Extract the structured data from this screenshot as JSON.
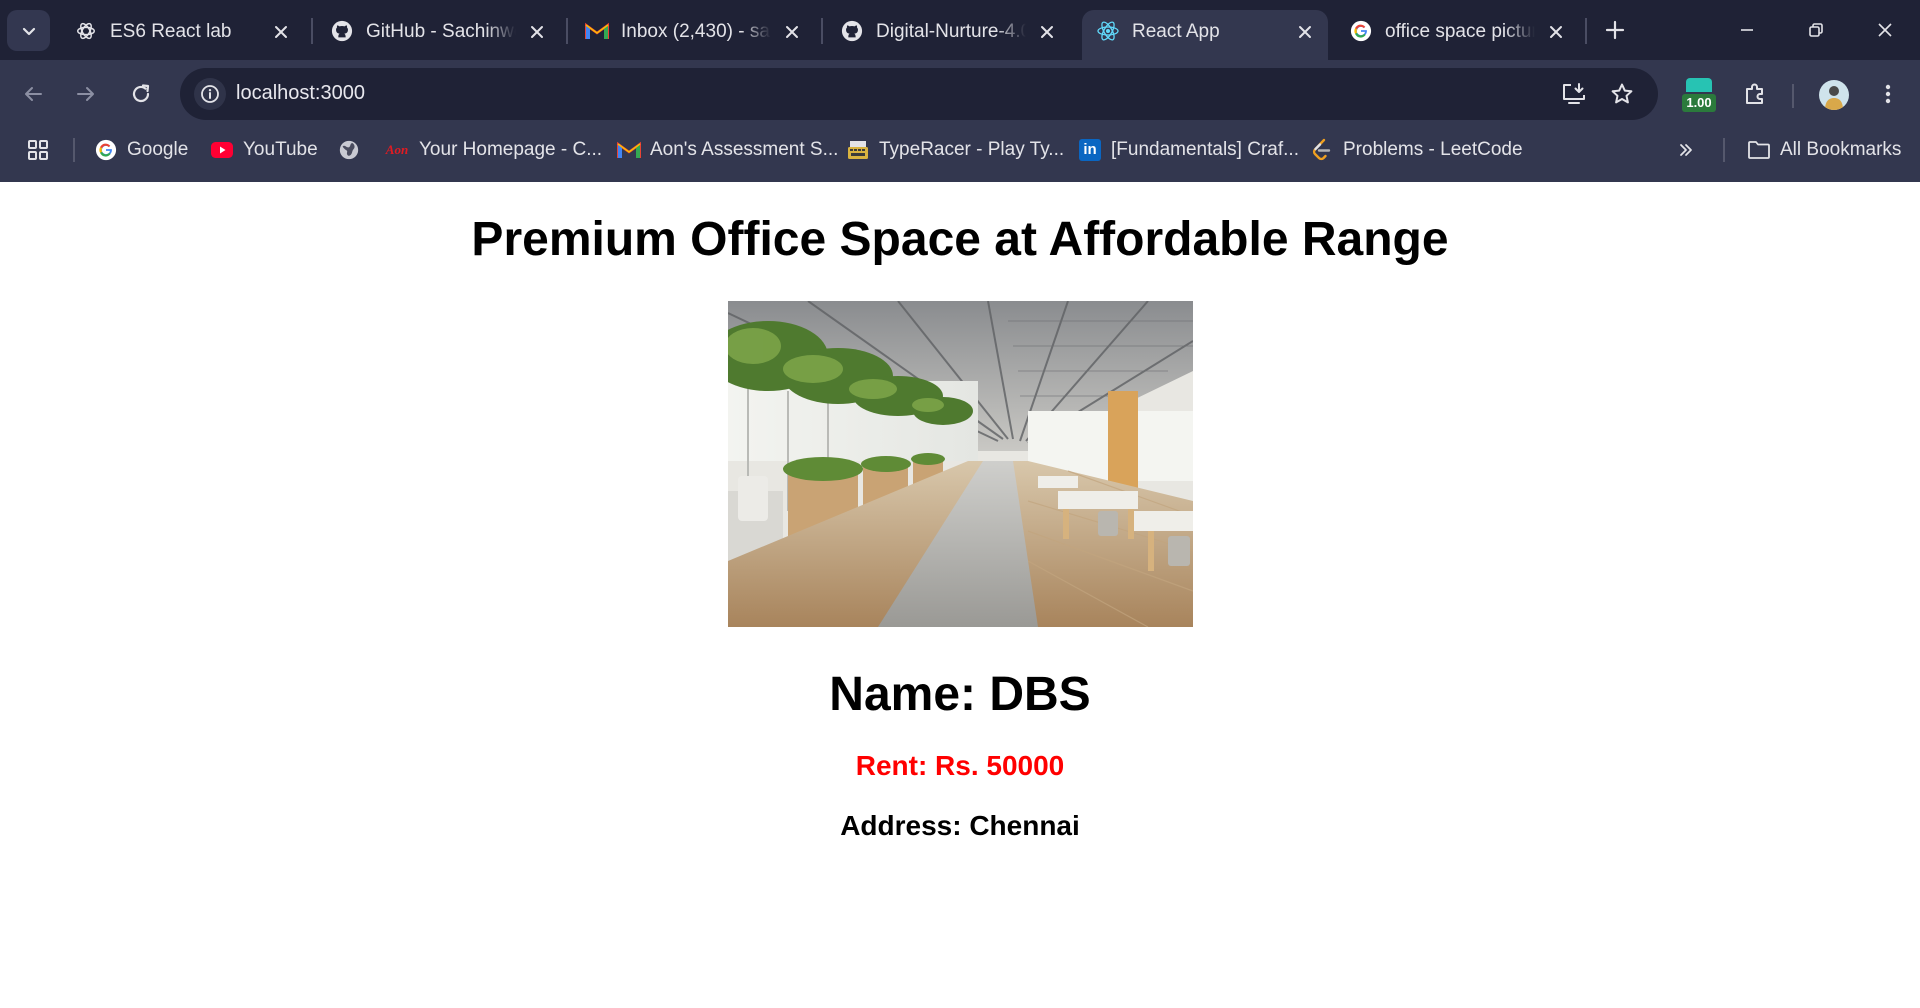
{
  "browser": {
    "tabs": [
      {
        "title": "ES6 React lab",
        "icon": "chatgpt-icon",
        "active": false
      },
      {
        "title": "GitHub - Sachinwe",
        "icon": "github-icon",
        "active": false
      },
      {
        "title": "Inbox (2,430) - sac",
        "icon": "gmail-icon",
        "active": false
      },
      {
        "title": "Digital-Nurture-4.0",
        "icon": "github-icon",
        "active": false
      },
      {
        "title": "React App",
        "icon": "react-icon",
        "active": true
      },
      {
        "title": "office space pictur",
        "icon": "google-icon",
        "active": false
      }
    ],
    "address_bar": {
      "url": "localhost:3000"
    },
    "extension_badge": "1.00",
    "bookmarks": [
      {
        "label": "Google",
        "icon": "google-icon"
      },
      {
        "label": "YouTube",
        "icon": "youtube-icon"
      },
      {
        "label": "",
        "icon": "globe-icon"
      },
      {
        "label": "Your Homepage - C...",
        "icon": "aon-icon"
      },
      {
        "label": "Aon's Assessment S...",
        "icon": "gmail-icon"
      },
      {
        "label": "TypeRacer - Play Ty...",
        "icon": "typeracer-icon"
      },
      {
        "label": "[Fundamentals] Craf...",
        "icon": "linkedin-icon"
      },
      {
        "label": "Problems - LeetCode",
        "icon": "leetcode-icon"
      }
    ],
    "all_bookmarks_label": "All Bookmarks",
    "aon_logo_text": "Aon",
    "linkedin_logo_text": "in"
  },
  "page": {
    "heading": "Premium Office Space at Affordable Range",
    "office": {
      "name_text": "Name: DBS",
      "rent_text": "Rent: Rs. 50000",
      "rent_color": "#ff0000",
      "address_text": "Address: Chennai"
    }
  }
}
